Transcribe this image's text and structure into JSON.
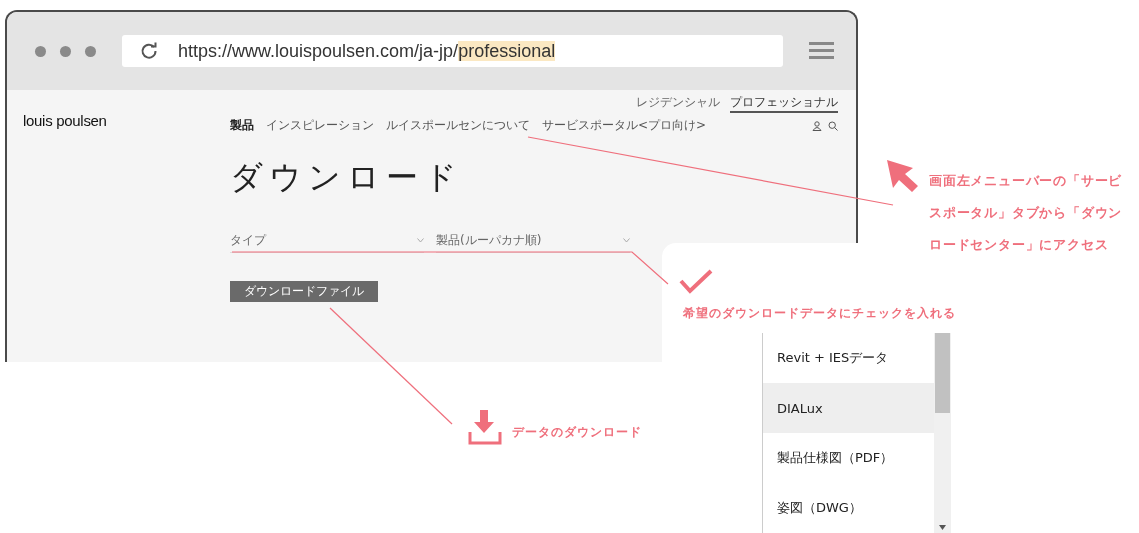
{
  "browser": {
    "url_prefix": "https://www.louispoulsen.com/ja-jp/",
    "url_highlight": "professional"
  },
  "site": {
    "logo": "louis poulsen",
    "nav": [
      {
        "label": "製品",
        "selected": true
      },
      {
        "label": "インスピレーション",
        "selected": false
      },
      {
        "label": "ルイスポールセンについて",
        "selected": false
      },
      {
        "label": "サービスポータル<プロ向け>",
        "selected": false
      }
    ],
    "audience_tabs": [
      {
        "label": "レジデンシャル",
        "selected": false
      },
      {
        "label": "プロフェッショナル",
        "selected": true
      }
    ],
    "title": "ダウンロード",
    "filters": [
      {
        "placeholder": "タイプ"
      },
      {
        "placeholder": "製品(ルーパカナ順)"
      }
    ],
    "download_button": "ダウンロードファイル"
  },
  "annotations": {
    "menu_note": "画面左メニューバーの「サービスポータル」タブから「ダウンロードセンター」にアクセス",
    "check_note": "希望のダウンロードデータにチェックを入れる",
    "download_note": "データのダウンロード"
  },
  "download_list": {
    "items": [
      {
        "label": "Revit + IESデータ",
        "selected": false
      },
      {
        "label": "DIALux",
        "selected": true
      },
      {
        "label": "製品仕様図（PDF）",
        "selected": false
      },
      {
        "label": "姿図（DWG）",
        "selected": false
      }
    ]
  }
}
